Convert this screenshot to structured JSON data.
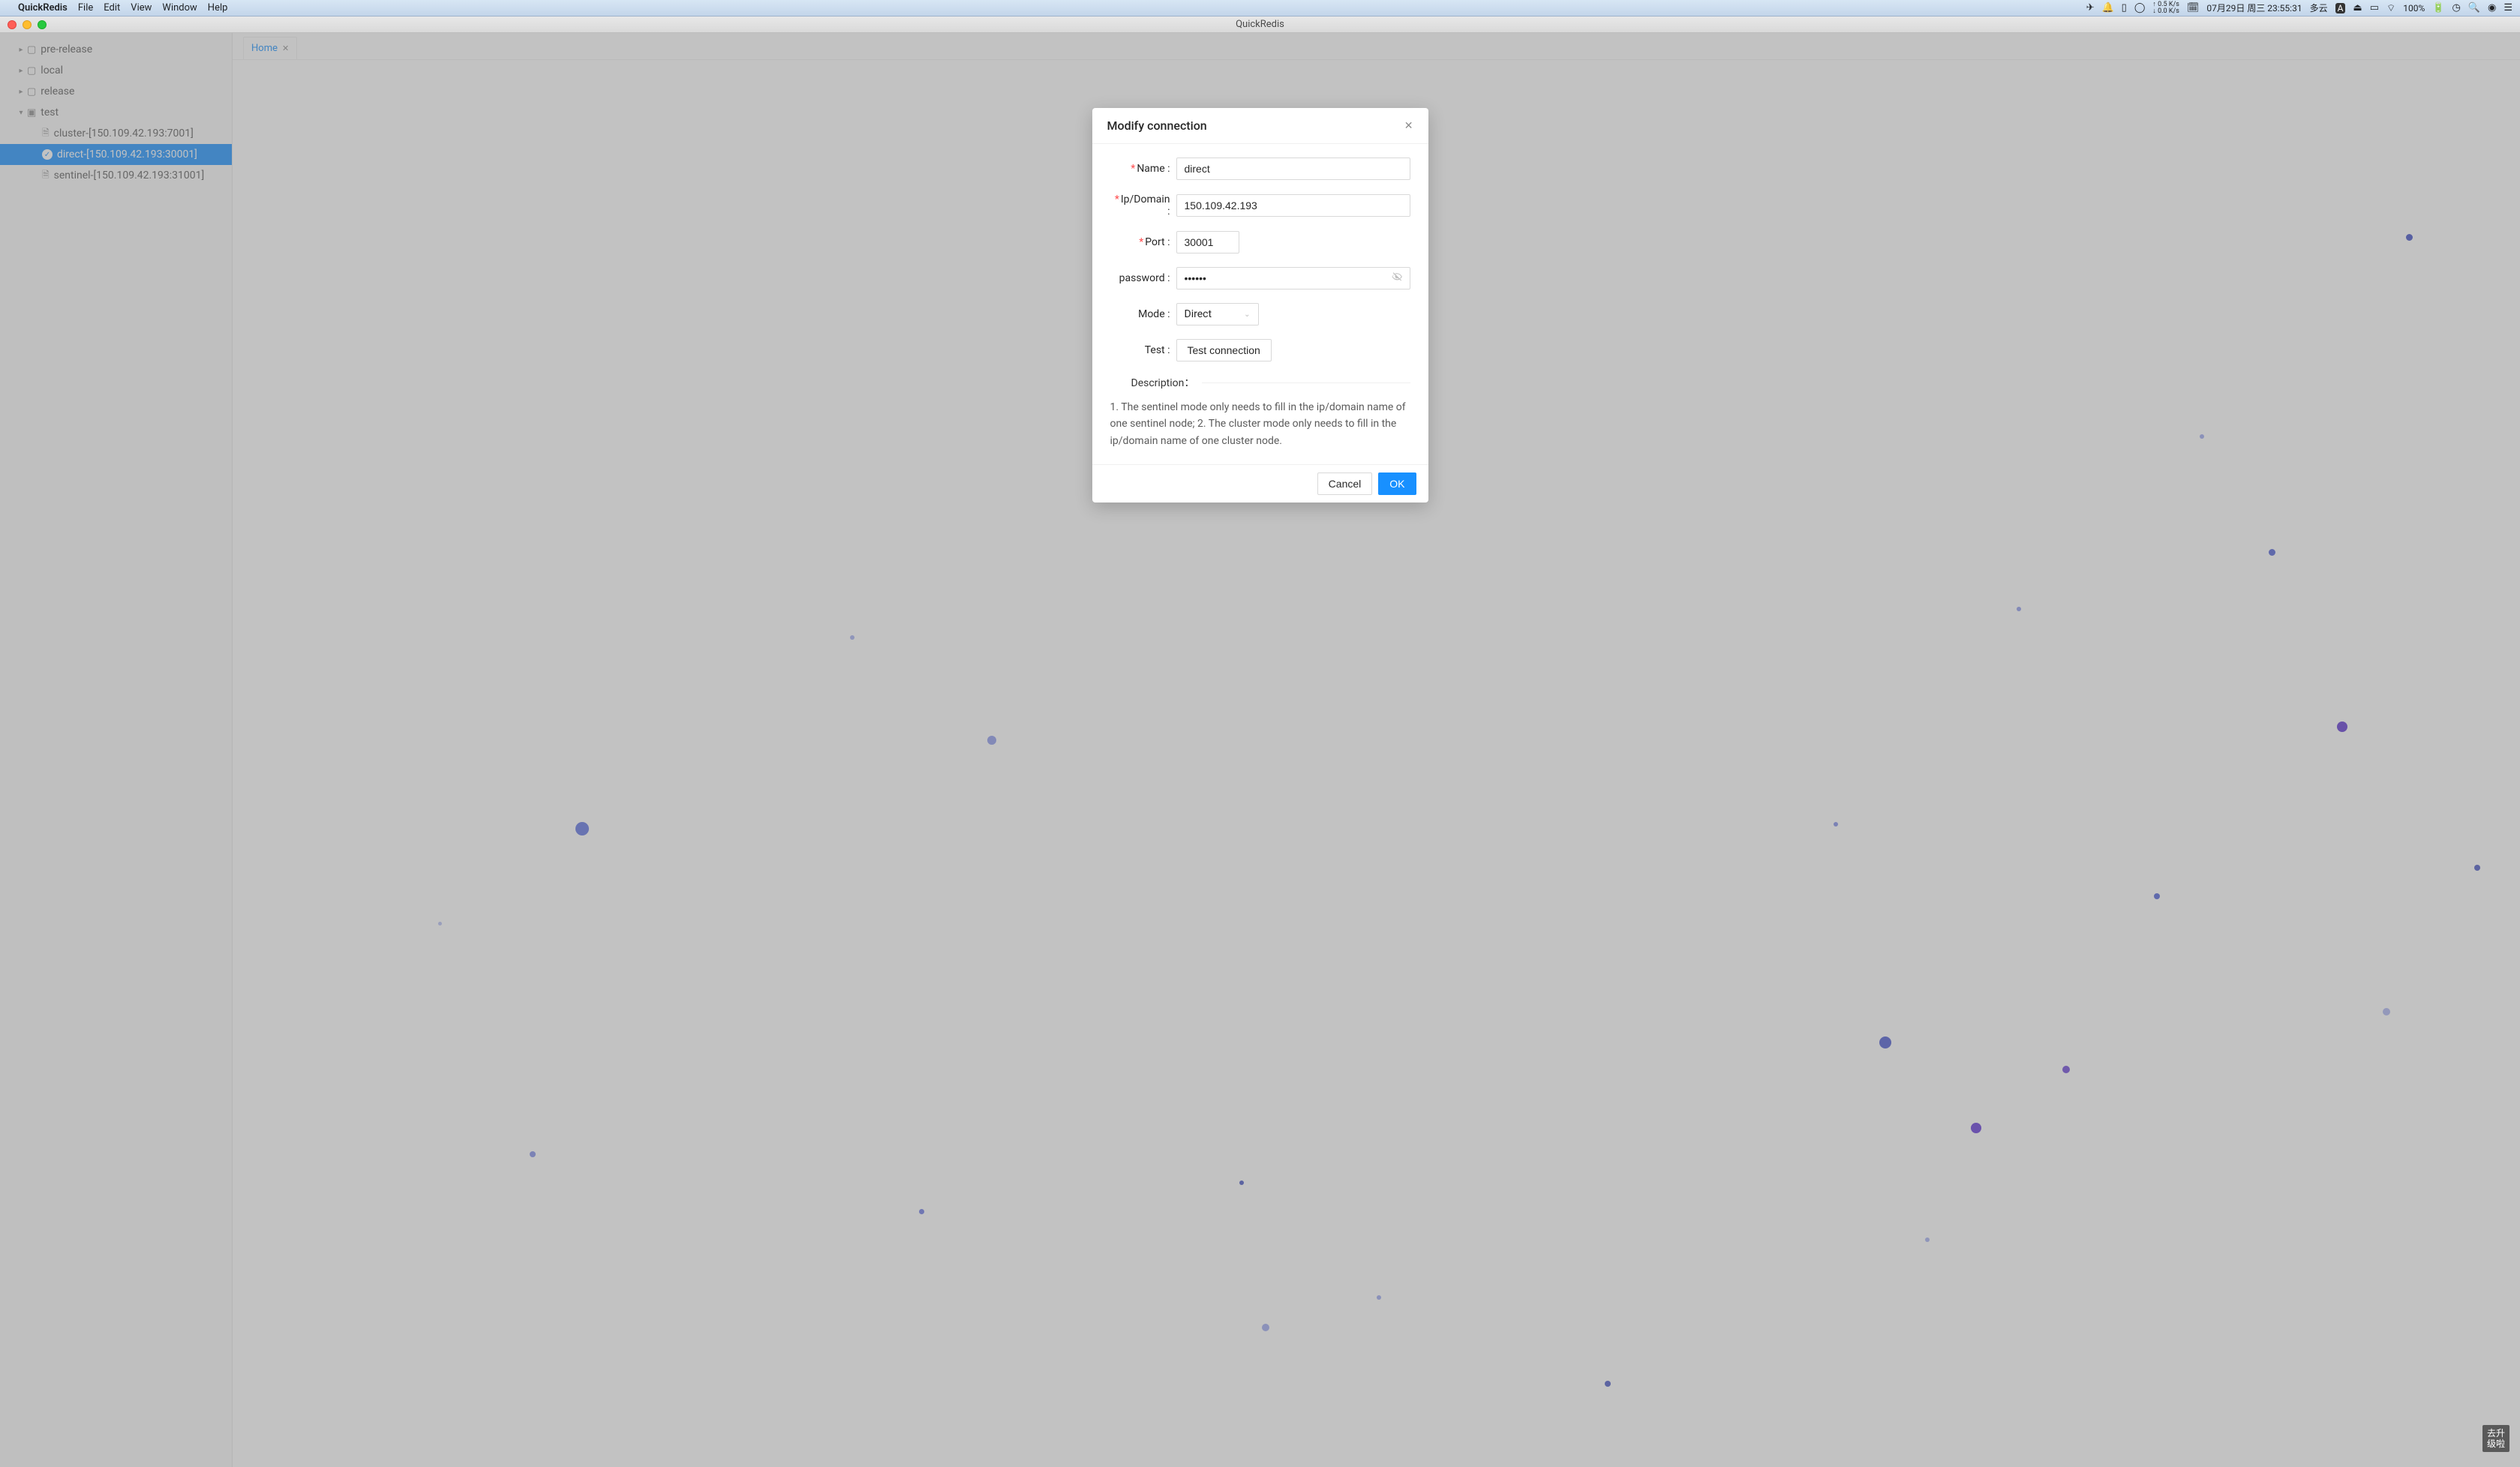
{
  "mac_menu": {
    "app": "QuickRedis",
    "items": [
      "File",
      "Edit",
      "View",
      "Window",
      "Help"
    ],
    "net_up": "0.5 K/s",
    "net_down": "0.0 K/s",
    "date": "07月29日 周三 23:55:31",
    "weather": "多云",
    "input_method": "A",
    "battery": "100%"
  },
  "window": {
    "title": "QuickRedis"
  },
  "sidebar": {
    "folders": [
      {
        "name": "pre-release",
        "expanded": false
      },
      {
        "name": "local",
        "expanded": false
      },
      {
        "name": "release",
        "expanded": false
      },
      {
        "name": "test",
        "expanded": true
      }
    ],
    "test_items": [
      {
        "label": "cluster-[150.109.42.193:7001]",
        "selected": false,
        "kind": "file"
      },
      {
        "label": "direct-[150.109.42.193:30001]",
        "selected": true,
        "kind": "check"
      },
      {
        "label": "sentinel-[150.109.42.193:31001]",
        "selected": false,
        "kind": "file"
      }
    ]
  },
  "tabs": {
    "home_label": "Home"
  },
  "modal": {
    "title": "Modify connection",
    "labels": {
      "name": "Name",
      "ipdomain": "Ip/Domain",
      "port": "Port",
      "password": "password",
      "mode": "Mode",
      "test": "Test",
      "description": "Description："
    },
    "values": {
      "name": "direct",
      "ipdomain": "150.109.42.193",
      "port": "30001",
      "password": "••••••",
      "mode": "Direct"
    },
    "test_button": "Test connection",
    "description_text": "1. The sentinel mode only needs to fill in the ip/domain name of one sentinel node; 2. The cluster mode only needs to fill in the ip/domain name of one cluster node.",
    "cancel": "Cancel",
    "ok": "OK"
  },
  "upgrade_badge": "去升\n级啦"
}
